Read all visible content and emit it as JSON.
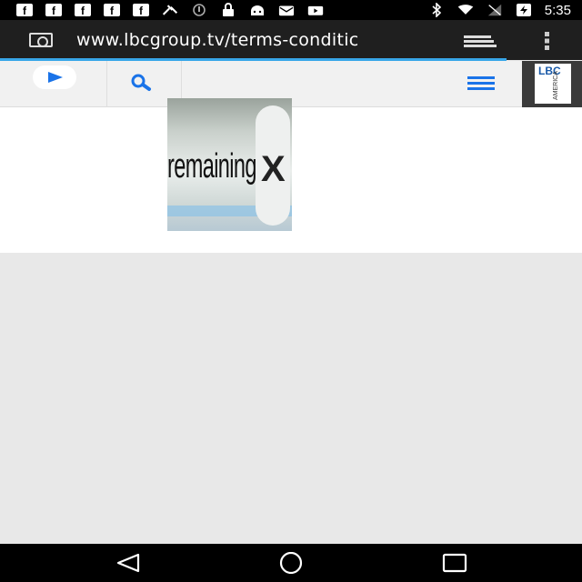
{
  "status_bar": {
    "notification_icons": [
      "facebook-icon",
      "facebook-icon",
      "facebook-icon",
      "facebook-icon",
      "facebook-icon",
      "satellite-icon",
      "sync-icon",
      "lock-icon",
      "android-icon",
      "mail-icon",
      "youtube-icon"
    ],
    "fb_glyph": "f",
    "time": "5:35",
    "system_icons": [
      "bluetooth-icon",
      "wifi-icon",
      "signal-icon",
      "battery-charging-icon"
    ]
  },
  "browser": {
    "url": "www.lbcgroup.tv/terms-conditic",
    "load_progress": 0.87
  },
  "site_header": {
    "logo_text": "LBC",
    "logo_subtext": "AMERICA"
  },
  "ad": {
    "text": "remaining",
    "close_glyph": "X"
  },
  "colors": {
    "accent_blue": "#1a73e8",
    "progress": "#38a6e8",
    "url_bar": "#1f1f1f"
  }
}
